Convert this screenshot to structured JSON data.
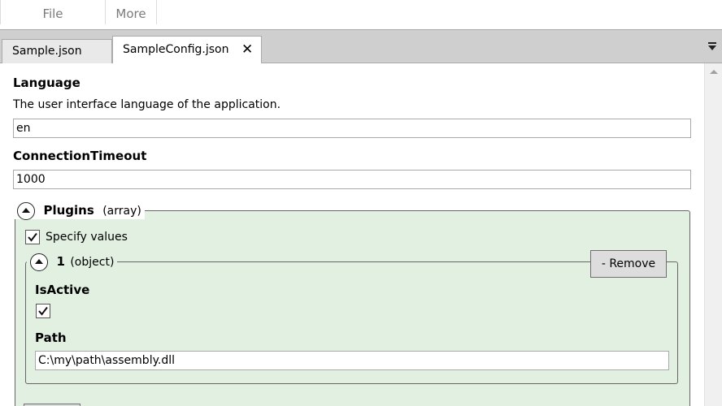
{
  "menu": {
    "file": "File",
    "more": "More"
  },
  "tabs": [
    {
      "label": "Sample.json"
    },
    {
      "label": "SampleConfig.json",
      "close": "✕"
    }
  ],
  "language": {
    "label": "Language",
    "description": "The user interface language of the application.",
    "value": "en"
  },
  "connection_timeout": {
    "label": "ConnectionTimeout",
    "value": "1000"
  },
  "plugins": {
    "title": "Plugins",
    "type": "(array)",
    "specify_values": "Specify values",
    "specify_checked": true,
    "item": {
      "index": "1",
      "type": "(object)",
      "remove_label": "- Remove",
      "is_active_label": "IsActive",
      "is_active_checked": true,
      "path_label": "Path",
      "path_value": "C:\\my\\path\\assembly.dll"
    }
  },
  "colors": {
    "group_bg": "#e1f0e1",
    "tabstrip_bg": "#cfcfcf"
  }
}
